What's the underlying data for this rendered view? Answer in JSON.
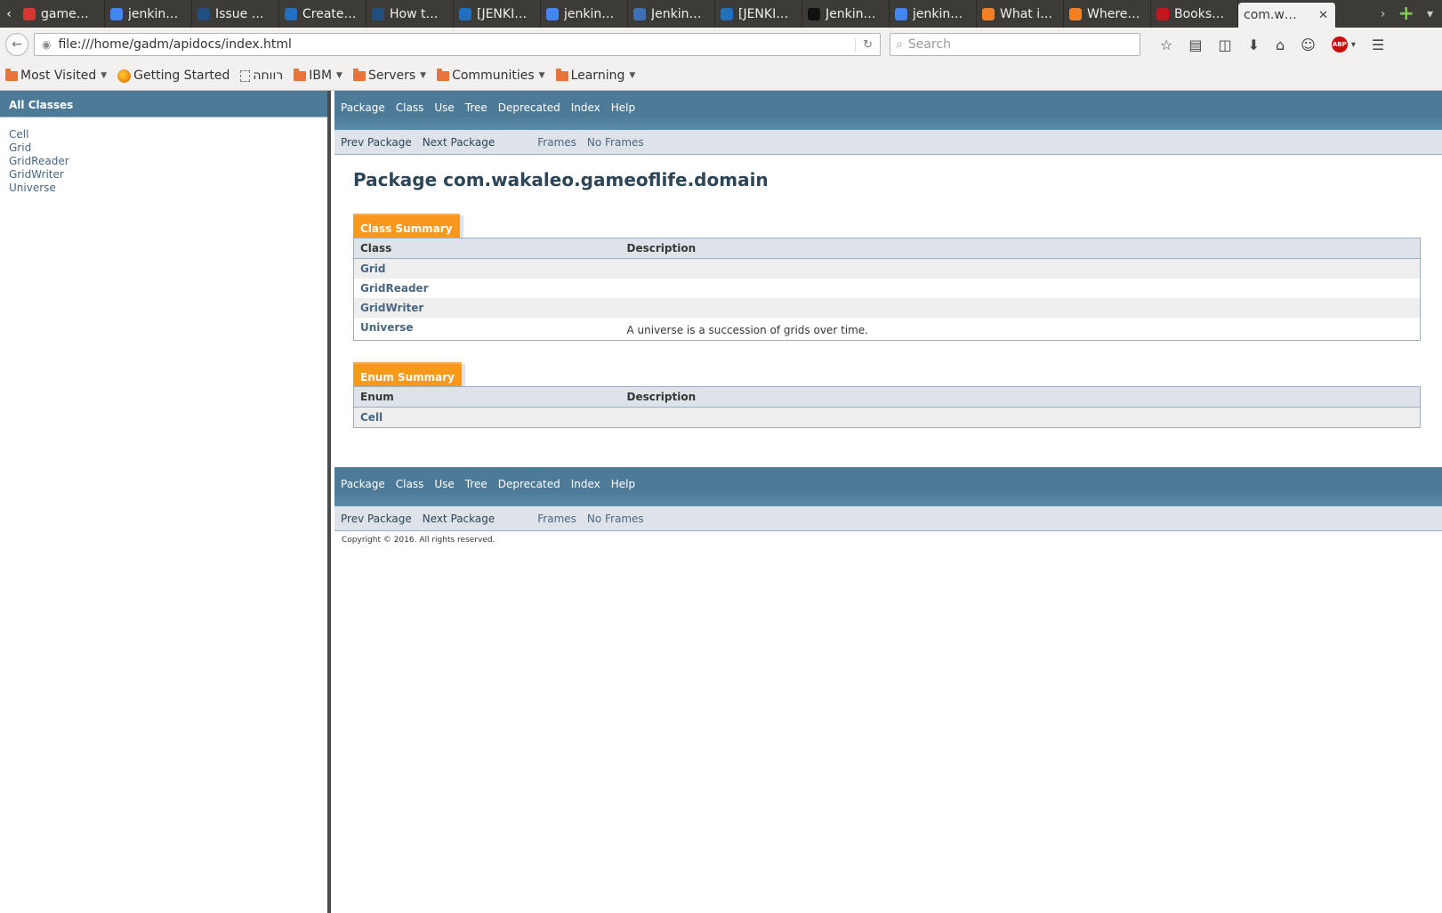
{
  "browser": {
    "tabs": [
      {
        "title": "game…",
        "icon": "jenkins-icon",
        "color": "#d33833"
      },
      {
        "title": "jenkin…",
        "icon": "google-icon",
        "color": "#4285f4"
      },
      {
        "title": "Issue …",
        "icon": "jira-icon",
        "color": "#205081"
      },
      {
        "title": "Create…",
        "icon": "ibm-icon",
        "color": "#1f70c1"
      },
      {
        "title": "How t…",
        "icon": "jira-icon",
        "color": "#205081"
      },
      {
        "title": "[JENKI…",
        "icon": "ibm-icon",
        "color": "#1f70c1"
      },
      {
        "title": "jenkin…",
        "icon": "google-icon",
        "color": "#4285f4"
      },
      {
        "title": "Jenkin…",
        "icon": "doc-icon",
        "color": "#3b6fb6"
      },
      {
        "title": "[JENKI…",
        "icon": "ibm-icon",
        "color": "#1f70c1"
      },
      {
        "title": "Jenkin…",
        "icon": "notion-icon",
        "color": "#111111"
      },
      {
        "title": "jenkin…",
        "icon": "google-icon",
        "color": "#4285f4"
      },
      {
        "title": "What i…",
        "icon": "stackoverflow-icon",
        "color": "#f48024"
      },
      {
        "title": "Where…",
        "icon": "stackoverflow-icon",
        "color": "#f48024"
      },
      {
        "title": "Books…",
        "icon": "safari-books-icon",
        "color": "#c4161c"
      }
    ],
    "active_tab": {
      "title": "com.w…",
      "close": "✕"
    },
    "url": "file:///home/gadm/apidocs/index.html",
    "search_placeholder": "Search",
    "abp_label": "ABP",
    "bookmarks": [
      {
        "label": "Most Visited",
        "icon": "folder-icon",
        "dropdown": true
      },
      {
        "label": "Getting Started",
        "icon": "firefox-icon",
        "dropdown": false
      },
      {
        "label": "רווחה",
        "icon": "page-icon",
        "dropdown": false
      },
      {
        "label": "IBM",
        "icon": "folder-icon",
        "dropdown": true
      },
      {
        "label": "Servers",
        "icon": "folder-icon",
        "dropdown": true
      },
      {
        "label": "Communities",
        "icon": "folder-icon",
        "dropdown": true
      },
      {
        "label": "Learning",
        "icon": "folder-icon",
        "dropdown": true
      }
    ]
  },
  "left_frame": {
    "heading": "All Classes",
    "classes": [
      "Cell",
      "Grid",
      "GridReader",
      "GridWriter",
      "Universe"
    ]
  },
  "nav": {
    "top_items": [
      "Package",
      "Class",
      "Use",
      "Tree",
      "Deprecated",
      "Index",
      "Help"
    ],
    "prev_package": "Prev Package",
    "next_package": "Next Package",
    "frames": "Frames",
    "no_frames": "No Frames"
  },
  "package_title": "Package com.wakaleo.gameoflife.domain",
  "class_summary": {
    "caption": "Class Summary",
    "col1": "Class",
    "col2": "Description",
    "rows": [
      {
        "name": "Grid",
        "desc": ""
      },
      {
        "name": "GridReader",
        "desc": ""
      },
      {
        "name": "GridWriter",
        "desc": ""
      },
      {
        "name": "Universe",
        "desc": "A universe is a succession of grids over time."
      }
    ]
  },
  "enum_summary": {
    "caption": "Enum Summary",
    "col1": "Enum",
    "col2": "Description",
    "rows": [
      {
        "name": "Cell",
        "desc": ""
      }
    ]
  },
  "copyright": "Copyright © 2016. All rights reserved.",
  "colors": {
    "header_blue": "#4d7a97",
    "caption_orange": "#f8981d",
    "link_blue": "#4a6782",
    "subnav_gray": "#dee3e9"
  }
}
